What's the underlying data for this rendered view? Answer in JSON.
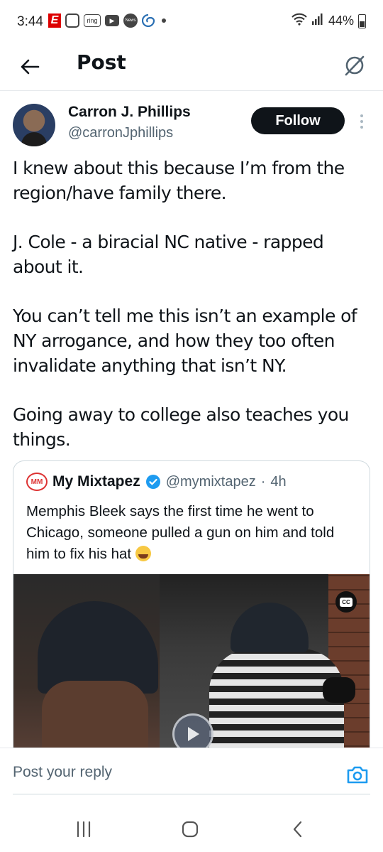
{
  "status": {
    "time": "3:44",
    "notification_icons": [
      "espn-icon",
      "instagram-icon",
      "ring-icon",
      "youtube-icon",
      "news-icon",
      "edge-icon"
    ],
    "ring_label": "ring",
    "news_label": "News",
    "battery": "44%"
  },
  "header": {
    "title": "Post"
  },
  "author": {
    "name": "Carron J. Phillips",
    "handle": "@carronJphillips",
    "follow_label": "Follow"
  },
  "post": {
    "paragraphs": [
      "I knew about this because I’m from the region/have family there.",
      "J. Cole - a biracial NC native - rapped about it.",
      "You can’t tell me this isn’t an example of NY arrogance, and how they too often invalidate anything that isn’t NY.",
      "Going away to college also teaches you things."
    ]
  },
  "quote": {
    "logo_text": "MM",
    "name": "My Mixtapez",
    "handle": "@mymixtapez",
    "separator": "·",
    "time": "4h",
    "text": "Memphis Bleek says the first time he went to Chicago, someone pulled a gun on him and told him to fix his hat",
    "cc_label": "CC",
    "verified_color": "#1d9bf0"
  },
  "reply": {
    "placeholder": "Post your reply"
  },
  "colors": {
    "accent": "#1d9bf0",
    "follow_bg": "#0f1419",
    "secondary_text": "#536471"
  }
}
